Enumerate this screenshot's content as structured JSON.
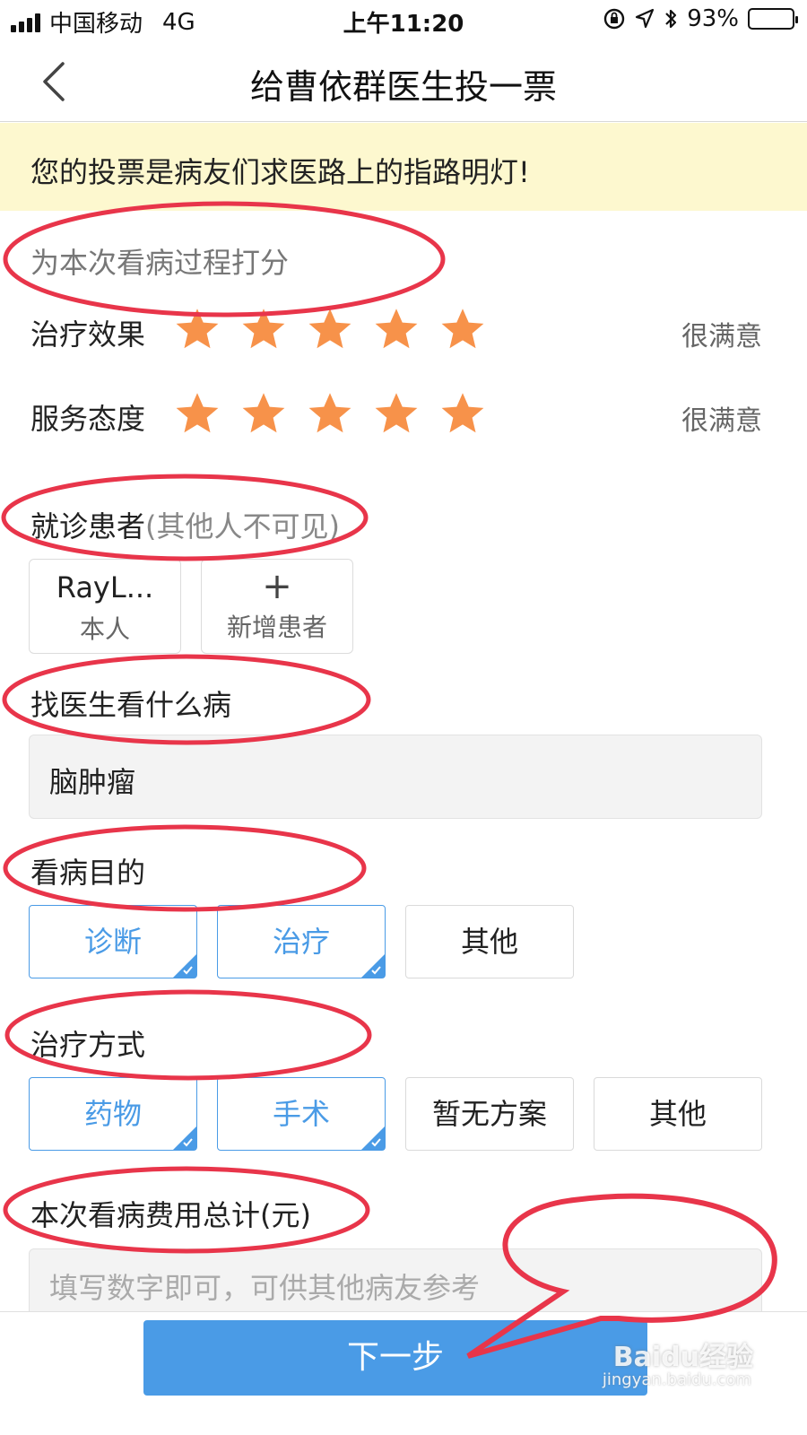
{
  "status_bar": {
    "carrier": "中国移动",
    "network": "4G",
    "time": "上午11:20",
    "battery": "93%",
    "battery_level": 0.93
  },
  "nav": {
    "title": "给曹依群医生投一票",
    "back_icon": "chevron-left-icon"
  },
  "banner": {
    "text": "您的投票是病友们求医路上的指路明灯!"
  },
  "rating": {
    "heading": "为本次看病过程打分",
    "star_color": "#f7924a",
    "items": [
      {
        "label": "治疗效果",
        "stars": 5,
        "max": 5,
        "result": "很满意"
      },
      {
        "label": "服务态度",
        "stars": 5,
        "max": 5,
        "result": "很满意"
      }
    ]
  },
  "patient": {
    "heading": "就诊患者",
    "heading_note": "(其他人不可见)",
    "cards": [
      {
        "name": "RayL...",
        "sub": "本人"
      },
      {
        "icon": "+",
        "sub": "新增患者"
      }
    ]
  },
  "disease": {
    "heading": "找医生看什么病",
    "value": "脑肿瘤"
  },
  "purpose": {
    "heading": "看病目的",
    "options": [
      {
        "label": "诊断",
        "selected": true
      },
      {
        "label": "治疗",
        "selected": true
      },
      {
        "label": "其他",
        "selected": false
      }
    ]
  },
  "treatment": {
    "heading": "治疗方式",
    "options": [
      {
        "label": "药物",
        "selected": true
      },
      {
        "label": "手术",
        "selected": true
      },
      {
        "label": "暂无方案",
        "selected": false
      },
      {
        "label": "其他",
        "selected": false
      }
    ]
  },
  "cost": {
    "heading": "本次看病费用总计(元)",
    "placeholder": "填写数字即可，可供其他病友参考",
    "value": ""
  },
  "footer": {
    "next_label": "下一步"
  },
  "watermark": {
    "brand": "Baidu经验",
    "url": "jingyan.baidu.com"
  },
  "colors": {
    "accent": "#4a9be6",
    "star": "#f7924a",
    "banner_bg": "#fdf8cf",
    "annotation": "#e8354a"
  }
}
